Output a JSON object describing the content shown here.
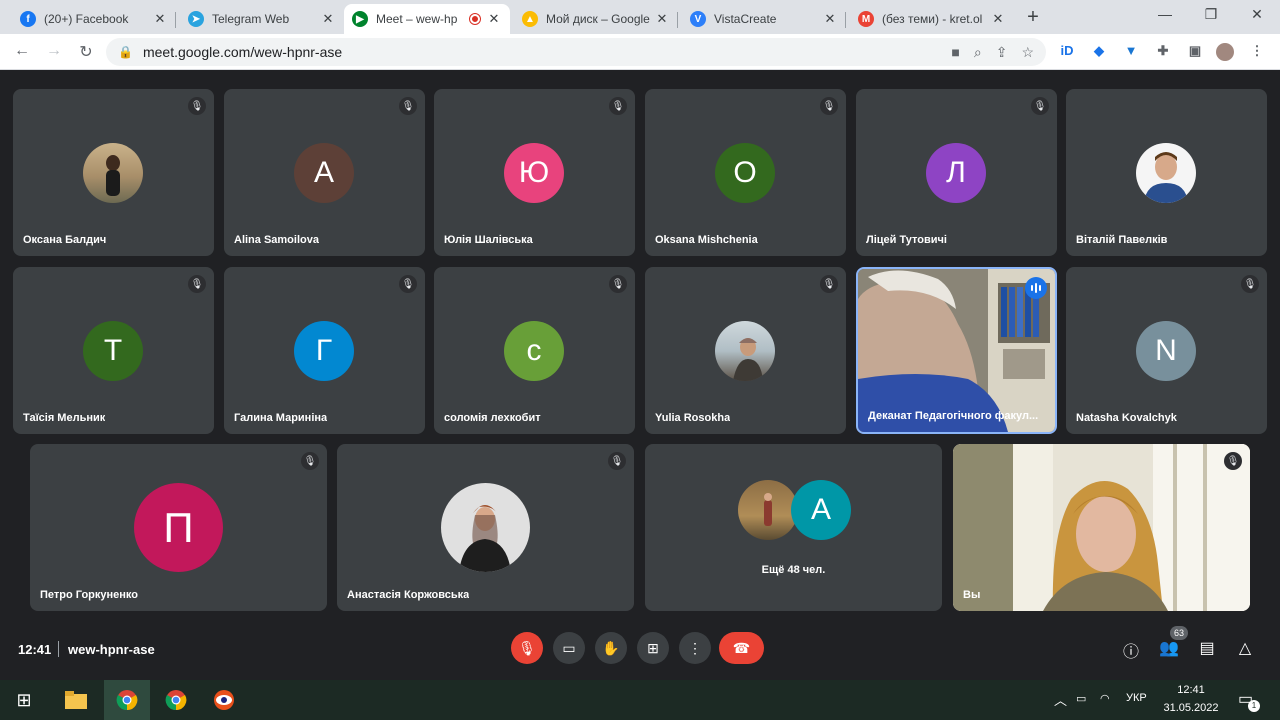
{
  "browser": {
    "tabs": [
      {
        "title": "(20+) Facebook",
        "favicon": "facebook-icon",
        "color": "#1877f2",
        "glyph": "f"
      },
      {
        "title": "Telegram Web",
        "favicon": "telegram-icon",
        "color": "#2aa3df",
        "glyph": "➤"
      },
      {
        "title": "Meet – wew-hp",
        "favicon": "meet-icon",
        "color": "#00832d",
        "glyph": "▶"
      },
      {
        "title": "Мой диск – Google",
        "favicon": "drive-icon",
        "color": "#fbbc04",
        "glyph": "▲"
      },
      {
        "title": "VistaCreate",
        "favicon": "vistacreate-icon",
        "color": "#2d7ff9",
        "glyph": "V"
      },
      {
        "title": "(без теми) - kret.ol",
        "favicon": "gmail-icon",
        "color": "#ea4335",
        "glyph": "M"
      }
    ],
    "url": "meet.google.com/wew-hpnr-ase"
  },
  "participants_row1": [
    {
      "name": "Оксана Балдич",
      "type": "photo",
      "photo": "woman-standing"
    },
    {
      "name": "Alina Samoilova",
      "type": "letter",
      "letter": "A",
      "color": "#5d4037"
    },
    {
      "name": "Юлія Шалівська",
      "type": "letter",
      "letter": "Ю",
      "color": "#e8437d"
    },
    {
      "name": "Oksana Mishchenia",
      "type": "letter",
      "letter": "O",
      "color": "#33691e"
    },
    {
      "name": "Ліцей Тутовичі",
      "type": "letter",
      "letter": "Л",
      "color": "#8e44c4"
    },
    {
      "name": "Віталій Павелків",
      "type": "photo",
      "photo": "man-blue-shirt"
    }
  ],
  "participants_row2": [
    {
      "name": "Таїсія Мельник",
      "type": "letter",
      "letter": "T",
      "color": "#33691e"
    },
    {
      "name": "Галина Маринiна",
      "type": "letter",
      "letter": "Г",
      "color": "#0288d1"
    },
    {
      "name": "соломія лехкобит",
      "type": "letter",
      "letter": "с",
      "color": "#689f38"
    },
    {
      "name": "Yulia Rosokha",
      "type": "photo",
      "photo": "woman-outdoor"
    },
    {
      "name": "Деканат Педагогічного факул...",
      "type": "video",
      "speaking": true
    },
    {
      "name": "Natasha Kovalchyk",
      "type": "letter",
      "letter": "N",
      "color": "#78909c"
    }
  ],
  "participants_row3": [
    {
      "name": "Петро Горкуненко",
      "type": "letter",
      "letter": "П",
      "color": "#c2185b"
    },
    {
      "name": "Анастасія Коржовська",
      "type": "photo",
      "photo": "woman-hat"
    },
    {
      "name": "",
      "type": "overflow",
      "letter": "A",
      "color": "#0097a7",
      "more_label": "Ещё 48 чел."
    },
    {
      "name": "Вы",
      "type": "self-video"
    }
  ],
  "bottombar": {
    "time": "12:41",
    "meeting_code": "wew-hpnr-ase",
    "people_count": "63"
  },
  "taskbar": {
    "language": "УКР",
    "time": "12:41",
    "date": "31.05.2022",
    "notifications": "1"
  }
}
